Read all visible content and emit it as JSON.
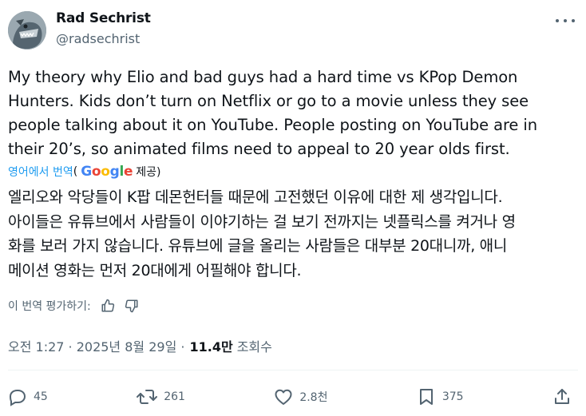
{
  "author": {
    "name": "Rad Sechrist",
    "handle": "@radsechrist"
  },
  "post": {
    "text": "My theory why Elio and bad guys had a hard time vs KPop Demon\nHunters. Kids don’t turn on Netflix or go to a movie unless they see\npeople talking about it on YouTube. People posting on YouTube are in\ntheir 20’s, so animated films need to appeal to 20 year olds first.",
    "translate_link": "영어에서 번역",
    "translate_open": "(",
    "translate_brand": "Google",
    "translate_provider": "제공)",
    "translated_text": "엘리오와 악당들이 K팝 데몬헌터들 때문에 고전했던 이유에 대한 제 생각입니다.\n아이들은 유튜브에서 사람들이 이야기하는 걸 보기 전까지는 넷플릭스를 켜거나 영\n화를 보러 가지 않습니다. 유튜브에 글을 올리는 사람들은 대부분 20대니까, 애니\n메이션 영화는 먼저 20대에게 어필해야 합니다.",
    "rate_label": "이 번역 평가하기:",
    "timestamp": "오전 1:27 · 2025년 8월 29일 ·",
    "views_count": "11.4만",
    "views_label": "조회수"
  },
  "actions": {
    "replies": "45",
    "reposts": "261",
    "likes": "2.8천",
    "bookmarks": "375"
  },
  "icons": [
    "more-icon",
    "thumbs-up-icon",
    "thumbs-down-icon",
    "reply-icon",
    "repost-icon",
    "like-icon",
    "bookmark-icon",
    "share-icon"
  ],
  "colors": {
    "link": "#1d9bf0",
    "muted": "#536471",
    "text": "#0f1419",
    "google_blue": "#4285F4",
    "google_red": "#EA4335",
    "google_yellow": "#FBBC05",
    "google_green": "#34A853"
  }
}
